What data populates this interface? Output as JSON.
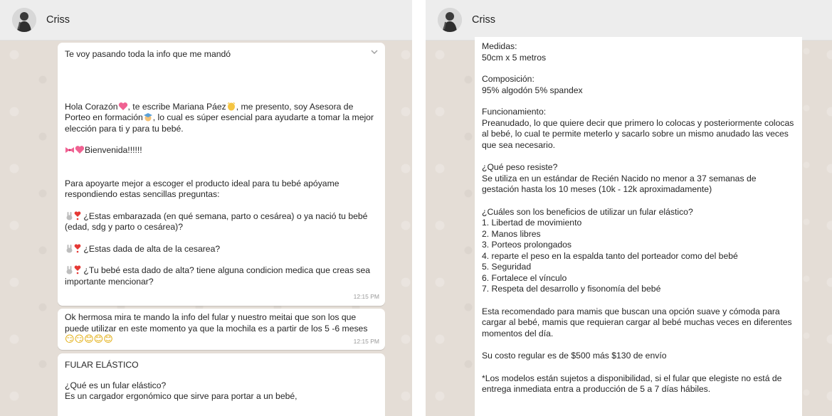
{
  "left": {
    "contact_name": "Criss",
    "message1": {
      "intro": "Te voy pasando toda la info que me mandó",
      "greeting_a": "Hola Corazón",
      "greeting_b": ", te escribe Mariana Páez",
      "greeting_c": ", me presento, soy Asesora de Porteo en formación",
      "greeting_d": ", lo cual es súper esencial para ayudarte a tomar la mejor elección para ti y para tu bebé.",
      "welcome": "Bienvenida!!!!!!",
      "help": "Para apoyarte mejor a escoger el producto ideal para tu bebé apóyame respondiendo estas sencillas preguntas:",
      "q1": "¿Estas embarazada (en qué semana, parto o cesárea) o ya nació tu bebé (edad, sdg y parto o cesárea)?",
      "q2": "¿Estas dada de alta de la cesarea?",
      "q3": "¿Tu bebé esta dado de alta? tiene alguna condicion medica que creas sea importante mencionar?",
      "time": "12:15 PM"
    },
    "message2": {
      "text": "Ok hermosa mira te mando la info del fular y nuestro meitai que son los que puede utilizar en este momento ya que la mochila es a partir de los 5 -6 meses",
      "emojis": "😏😏😊😊😊",
      "time": "12:15 PM"
    },
    "message3": {
      "title": "FULAR ELÁSTICO",
      "question": "¿Qué es un fular elástico?",
      "answer": "Es un cargador ergonómico que sirve para portar a un bebé,"
    },
    "icons": {
      "heart": "pink-heart-icon",
      "wave": "waving-hand-icon",
      "student": "student-icon",
      "bow": "ribbon-bow-icon",
      "bunny": "bunny-icon",
      "exclaim": "red-exclamation-heart-icon",
      "chevron": "chevron-down-icon"
    }
  },
  "right": {
    "contact_name": "Criss",
    "medidas_label": "Medidas:",
    "medidas_value": "50cm x 5 metros",
    "composicion_label": "Composición:",
    "composicion_value": "95% algodón 5% spandex",
    "funcionamiento_label": "Funcionamiento:",
    "funcionamiento_value": "Preanudado, lo que quiere decir que primero lo colocas y posteriormente colocas al bebé, lo cual te permite meterlo y sacarlo sobre un mismo anudado las veces que sea necesario.",
    "peso_label": "¿Qué peso resiste?",
    "peso_value": "Se utiliza en un estándar de Recién Nacido no menor a 37 semanas de gestación hasta los 10 meses (10k - 12k aproximadamente)",
    "beneficios_label": "¿Cuáles son los beneficios de utilizar un fular elástico?",
    "beneficios": [
      "1. Libertad de movimiento",
      "2. Manos libres",
      "3. Porteos prolongados",
      "4. reparte el peso en la espalda tanto del porteador como del bebé",
      "5. Seguridad",
      "6. Fortalece el vínculo",
      "7. Respeta del desarrollo y fisonomía del bebé"
    ],
    "recomendado": "Esta recomendado para mamis que buscan una opción suave y cómoda para cargar al bebé, mamis que requieran cargar al bebé muchas veces en diferentes momentos del día.",
    "costo": "Su costo regular es de $500 más $130 de envío",
    "nota": "*Los modelos están sujetos a disponibilidad, si el fular que elegiste no está de entrega inmediata entra a producción de 5 a 7 días hábiles."
  }
}
